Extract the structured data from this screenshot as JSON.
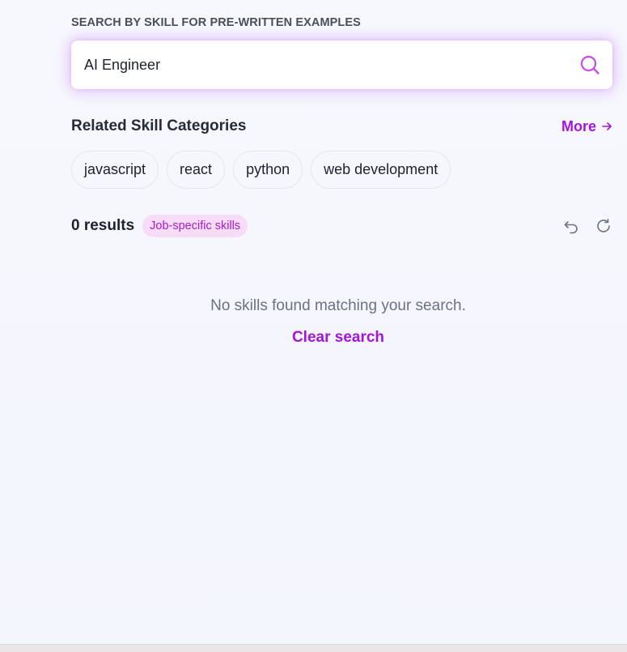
{
  "search": {
    "section_label": "SEARCH BY SKILL FOR PRE-WRITTEN EXAMPLES",
    "value": "AI Engineer",
    "icon": "search-icon",
    "accent_color": "#a515d8"
  },
  "related": {
    "title": "Related Skill Categories",
    "more_label": "More",
    "more_icon": "arrow-right-icon",
    "chips": [
      "javascript",
      "react",
      "python",
      "web development"
    ]
  },
  "results": {
    "count_label": "0 results",
    "badge": "Job-specific skills",
    "actions": [
      "undo-icon",
      "refresh-icon"
    ]
  },
  "empty_state": {
    "message": "No skills found matching your search.",
    "clear_label": "Clear search"
  }
}
